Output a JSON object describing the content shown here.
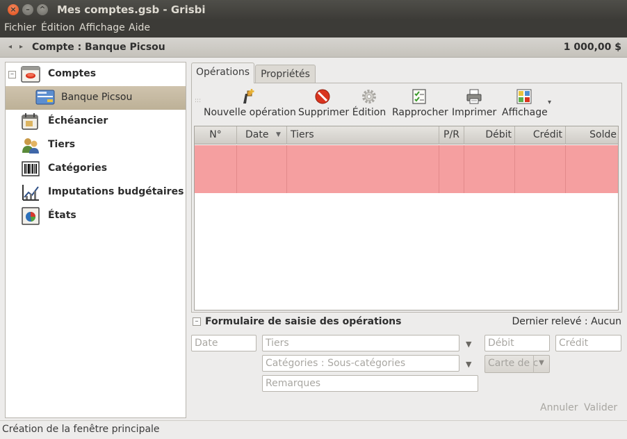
{
  "window": {
    "title": "Mes comptes.gsb - Grisbi",
    "close_glyph": "×",
    "min_glyph": "–",
    "max_glyph": "^"
  },
  "menu": [
    "Fichier",
    "Édition",
    "Affichage",
    "Aide"
  ],
  "header": {
    "prev_glyph": "◂",
    "next_glyph": "▸",
    "account_title": "Compte : Banque Picsou",
    "balance": "1 000,00 $"
  },
  "tree": {
    "expander": "–",
    "items": [
      {
        "label": "Comptes",
        "icon": "accounts-icon"
      },
      {
        "label": "Banque Picsou",
        "icon": "bank-card-icon"
      },
      {
        "label": "Échéancier",
        "icon": "calendar-icon"
      },
      {
        "label": "Tiers",
        "icon": "people-icon"
      },
      {
        "label": "Catégories",
        "icon": "barcode-icon"
      },
      {
        "label": "Imputations budgétaires",
        "icon": "budget-chart-icon"
      },
      {
        "label": "États",
        "icon": "report-icon"
      }
    ]
  },
  "tabs": [
    {
      "label": "Opérations",
      "active": true
    },
    {
      "label": "Propriétés",
      "active": false
    }
  ],
  "toolbar": {
    "grip": ":::",
    "more_glyph": "▾",
    "buttons": [
      {
        "label": "Nouvelle opération",
        "icon": "new-transaction-icon"
      },
      {
        "label": "Supprimer",
        "icon": "delete-icon"
      },
      {
        "label": "Édition",
        "icon": "gear-icon"
      },
      {
        "label": "Rapprocher",
        "icon": "reconcile-checklist-icon"
      },
      {
        "label": "Imprimer",
        "icon": "printer-icon"
      },
      {
        "label": "Affichage",
        "icon": "display-icon"
      }
    ]
  },
  "list": {
    "columns": [
      "N°",
      "Date",
      "Tiers",
      "P/R",
      "Débit",
      "Crédit",
      "Solde"
    ],
    "sort_glyph": "▼",
    "highlight_color": "#f59fa0"
  },
  "form": {
    "toggle": "–",
    "title": "Formulaire de saisie des opérations",
    "last_statement": "Dernier relevé : Aucun",
    "date_placeholder": "Date",
    "payee_placeholder": "Tiers",
    "debit_placeholder": "Débit",
    "credit_placeholder": "Crédit",
    "category_placeholder": "Catégories : Sous-catégories",
    "payment_method": "Carte de c",
    "notes_placeholder": "Remarques",
    "cancel_label": "Annuler",
    "validate_label": "Valider",
    "arrow_glyph": "▼"
  },
  "status": "Création de la fenêtre principale"
}
